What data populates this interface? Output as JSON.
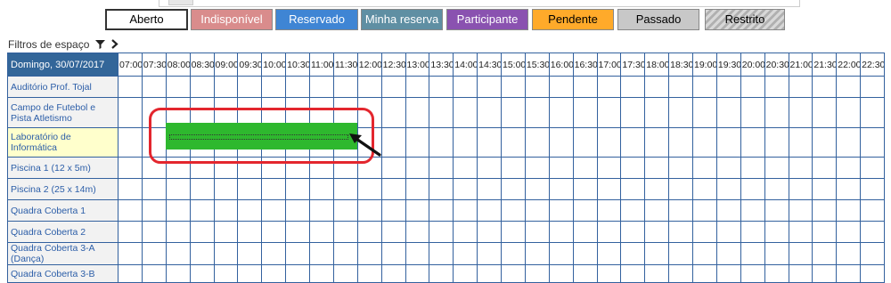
{
  "legend": [
    {
      "label": "Aberto",
      "bg": "#ffffff",
      "color": "#000000"
    },
    {
      "label": "Indisponível",
      "bg": "#d98c8c",
      "color": "#ffffff"
    },
    {
      "label": "Reservado",
      "bg": "#3f85d4",
      "color": "#ffffff"
    },
    {
      "label": "Minha reserva",
      "bg": "#5f8fa3",
      "color": "#ffffff"
    },
    {
      "label": "Participante",
      "bg": "#8a52b0",
      "color": "#ffffff"
    },
    {
      "label": "Pendente",
      "bg": "#ffaa2a",
      "color": "#000000"
    },
    {
      "label": "Passado",
      "bg": "#c8c8c8",
      "color": "#000000"
    },
    {
      "label": "Restrito",
      "bg": "#c8c8c8",
      "color": "#000000"
    }
  ],
  "filters": {
    "label": "Filtros de espaço"
  },
  "grid": {
    "date": "Domingo, 30/07/2017",
    "hours": [
      "07:00",
      "07:30",
      "08:00",
      "08:30",
      "09:00",
      "09:30",
      "10:00",
      "10:30",
      "11:00",
      "11:30",
      "12:00",
      "12:30",
      "13:00",
      "13:30",
      "14:00",
      "14:30",
      "15:00",
      "15:30",
      "16:00",
      "16:30",
      "17:00",
      "17:30",
      "18:00",
      "18:30",
      "19:00",
      "19:30",
      "20:00",
      "20:30",
      "21:00",
      "21:30",
      "22:00",
      "22:30"
    ],
    "rooms": [
      "Auditório Prof. Tojal",
      "Campo de Futebol e Pista Atletismo",
      "Laboratório de Informática",
      "Piscina 1 (12 x 5m)",
      "Piscina 2 (25 x 14m)",
      "Quadra Coberta 1",
      "Quadra Coberta 2",
      "Quadra Coberta 3-A (Dança)",
      "Quadra Coberta 3-B"
    ],
    "selected_room_index": 2
  },
  "colors": {
    "booking": "#2eb82e",
    "highlight": "#e3262e",
    "header": "#336699"
  },
  "icons": {
    "filter": "funnel-icon",
    "expand": "chevron-right-icon"
  }
}
